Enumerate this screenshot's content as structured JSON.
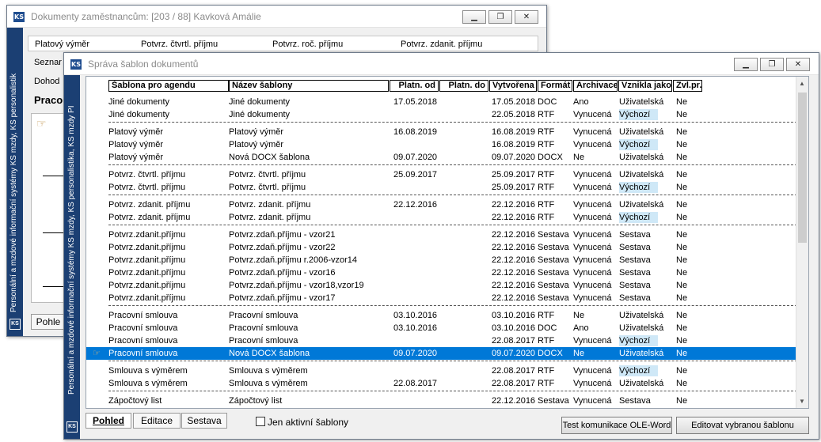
{
  "back_window": {
    "title": "Dokumenty zaměstnancům: [203 / 88] Kavková Amálie",
    "top_headers": [
      "Platový výměr",
      "Potvrz. čtvrtl. příjmu",
      "Potvrz. roč. příjmu",
      "Potvrz. zdanit. příjmu"
    ],
    "left_items": [
      "Seznar",
      "Dohod",
      "Praco"
    ],
    "bottom_tab": "Pohle",
    "sidebar_text": "Personální a mzdové informační systémy KS mzdy, KS personalistik"
  },
  "front_window": {
    "title": "Správa šablon dokumentů",
    "sidebar_text": "Personální a mzdové informační systémy KS mzdy, KS personalistika, KS mzdy PI",
    "columns": [
      "Šablona pro agendu",
      "Název šablony",
      "Platn. od",
      "Platn. do",
      "Vytvořena",
      "Formát",
      "Archivace",
      "Vznikla jako",
      "Zvl.pr."
    ],
    "rows": [
      {
        "agenda": "Jiné dokumenty",
        "nazev": "Jiné dokumenty",
        "od": "17.05.2018",
        "do": "",
        "vytvorena": "17.05.2018",
        "format": "DOC",
        "archivace": "Ano",
        "vznikla": "Uživatelská",
        "zvl": "Ne"
      },
      {
        "agenda": "Jiné dokumenty",
        "nazev": "Jiné dokumenty",
        "od": "",
        "do": "",
        "vytvorena": "22.05.2018",
        "format": "RTF",
        "archivace": "Vynucená",
        "vznikla": "Výchozí",
        "zvl": "Ne"
      },
      {
        "agenda": "Platový výměr",
        "nazev": "Platový výměr",
        "od": "16.08.2019",
        "do": "",
        "vytvorena": "16.08.2019",
        "format": "RTF",
        "archivace": "Vynucená",
        "vznikla": "Uživatelská",
        "zvl": "Ne"
      },
      {
        "agenda": "Platový výměr",
        "nazev": "Platový výměr",
        "od": "",
        "do": "",
        "vytvorena": "16.08.2019",
        "format": "RTF",
        "archivace": "Vynucená",
        "vznikla": "Výchozí",
        "zvl": "Ne"
      },
      {
        "agenda": "Platový výměr",
        "nazev": "Nová DOCX šablona",
        "od": "09.07.2020",
        "do": "",
        "vytvorena": "09.07.2020",
        "format": "DOCX",
        "archivace": "Ne",
        "vznikla": "Uživatelská",
        "zvl": "Ne"
      },
      {
        "agenda": "Potvrz. čtvrtl. příjmu",
        "nazev": "Potvrz. čtvrtl. příjmu",
        "od": "25.09.2017",
        "do": "",
        "vytvorena": "25.09.2017",
        "format": "RTF",
        "archivace": "Vynucená",
        "vznikla": "Uživatelská",
        "zvl": "Ne"
      },
      {
        "agenda": "Potvrz. čtvrtl. příjmu",
        "nazev": "Potvrz. čtvrtl. příjmu",
        "od": "",
        "do": "",
        "vytvorena": "25.09.2017",
        "format": "RTF",
        "archivace": "Vynucená",
        "vznikla": "Výchozí",
        "zvl": "Ne"
      },
      {
        "agenda": "Potvrz. zdanit. příjmu",
        "nazev": "Potvrz. zdanit. příjmu",
        "od": "22.12.2016",
        "do": "",
        "vytvorena": "22.12.2016",
        "format": "RTF",
        "archivace": "Vynucená",
        "vznikla": "Uživatelská",
        "zvl": "Ne"
      },
      {
        "agenda": "Potvrz. zdanit. příjmu",
        "nazev": "Potvrz. zdanit. příjmu",
        "od": "",
        "do": "",
        "vytvorena": "22.12.2016",
        "format": "RTF",
        "archivace": "Vynucená",
        "vznikla": "Výchozí",
        "zvl": "Ne"
      },
      {
        "agenda": "Potvrz.zdanit.příjmu",
        "nazev": "Potvrz.zdaň.příjmu - vzor21",
        "od": "",
        "do": "",
        "vytvorena": "22.12.2016",
        "format": "Sestava",
        "archivace": "Vynucená",
        "vznikla": "Sestava",
        "zvl": "Ne"
      },
      {
        "agenda": "Potvrz.zdanit.příjmu",
        "nazev": "Potvrz.zdaň.příjmu - vzor22",
        "od": "",
        "do": "",
        "vytvorena": "22.12.2016",
        "format": "Sestava",
        "archivace": "Vynucená",
        "vznikla": "Sestava",
        "zvl": "Ne"
      },
      {
        "agenda": "Potvrz.zdanit.příjmu",
        "nazev": "Potvrz.zdaň.příjmu r.2006-vzor14",
        "od": "",
        "do": "",
        "vytvorena": "22.12.2016",
        "format": "Sestava",
        "archivace": "Vynucená",
        "vznikla": "Sestava",
        "zvl": "Ne"
      },
      {
        "agenda": "Potvrz.zdanit.příjmu",
        "nazev": "Potvrz.zdaň.příjmu - vzor16",
        "od": "",
        "do": "",
        "vytvorena": "22.12.2016",
        "format": "Sestava",
        "archivace": "Vynucená",
        "vznikla": "Sestava",
        "zvl": "Ne"
      },
      {
        "agenda": "Potvrz.zdanit.příjmu",
        "nazev": "Potvrz.zdaň.příjmu - vzor18,vzor19",
        "od": "",
        "do": "",
        "vytvorena": "22.12.2016",
        "format": "Sestava",
        "archivace": "Vynucená",
        "vznikla": "Sestava",
        "zvl": "Ne"
      },
      {
        "agenda": "Potvrz.zdanit.příjmu",
        "nazev": "Potvrz.zdaň.příjmu - vzor17",
        "od": "",
        "do": "",
        "vytvorena": "22.12.2016",
        "format": "Sestava",
        "archivace": "Vynucená",
        "vznikla": "Sestava",
        "zvl": "Ne"
      },
      {
        "agenda": "Pracovní smlouva",
        "nazev": "Pracovní smlouva",
        "od": "03.10.2016",
        "do": "",
        "vytvorena": "03.10.2016",
        "format": "RTF",
        "archivace": "Ne",
        "vznikla": "Uživatelská",
        "zvl": "Ne"
      },
      {
        "agenda": "Pracovní smlouva",
        "nazev": "Pracovní smlouva",
        "od": "03.10.2016",
        "do": "",
        "vytvorena": "03.10.2016",
        "format": "DOC",
        "archivace": "Ano",
        "vznikla": "Uživatelská",
        "zvl": "Ne"
      },
      {
        "agenda": "Pracovní smlouva",
        "nazev": "Pracovní smlouva",
        "od": "",
        "do": "",
        "vytvorena": "22.08.2017",
        "format": "RTF",
        "archivace": "Vynucená",
        "vznikla": "Výchozí",
        "zvl": "Ne"
      },
      {
        "agenda": "Pracovní smlouva",
        "nazev": "Nová DOCX šablona",
        "od": "09.07.2020",
        "do": "",
        "vytvorena": "09.07.2020",
        "format": "DOCX",
        "archivace": "Ne",
        "vznikla": "Uživatelská",
        "zvl": "Ne"
      },
      {
        "agenda": "Smlouva s výměrem",
        "nazev": "Smlouva s výměrem",
        "od": "",
        "do": "",
        "vytvorena": "22.08.2017",
        "format": "RTF",
        "archivace": "Vynucená",
        "vznikla": "Výchozí",
        "zvl": "Ne"
      },
      {
        "agenda": "Smlouva s výměrem",
        "nazev": "Smlouva s výměrem",
        "od": "22.08.2017",
        "do": "",
        "vytvorena": "22.08.2017",
        "format": "RTF",
        "archivace": "Vynucená",
        "vznikla": "Uživatelská",
        "zvl": "Ne"
      },
      {
        "agenda": "Zápočtový list",
        "nazev": "Zápočtový list",
        "od": "",
        "do": "",
        "vytvorena": "22.12.2016",
        "format": "Sestava",
        "archivace": "Vynucená",
        "vznikla": "Sestava",
        "zvl": "Ne"
      }
    ],
    "selected_row": 18,
    "bottom_tabs": [
      "Pohled",
      "Editace",
      "Sestava"
    ],
    "checkbox_label": "Jen aktivní šablony",
    "btn_test": "Test komunikace OLE-Word",
    "btn_edit": "Editovat vybranou šablonu"
  },
  "colors": {
    "selection": "#0078d7",
    "sidebar": "#1b3f73",
    "highlight_vychozi": "#cfe8f7"
  }
}
